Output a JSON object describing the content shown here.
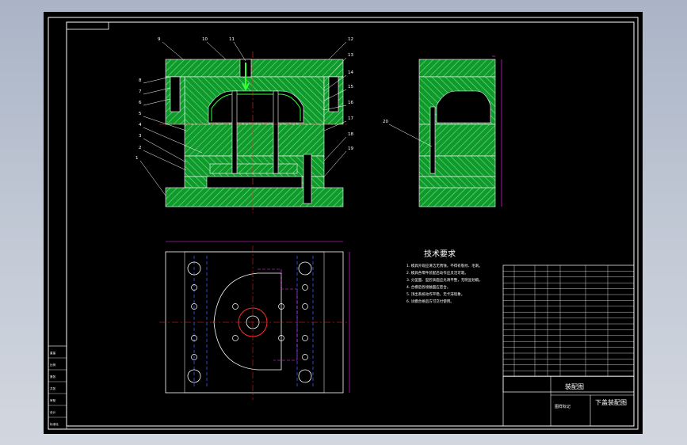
{
  "colors": {
    "canvas_bg": "#aab4c6",
    "sheet_bg": "#000000",
    "frame": "#ffffff",
    "steel": "#0f9a2c",
    "steel_hatch": "#7fe090",
    "centerline": "#ff2a2a",
    "dimension": "#ff33ff",
    "hidden": "#3a5cff",
    "annotation": "#ffffff",
    "highlight": "#33ff33"
  },
  "balloons_front": [
    "1",
    "2",
    "3",
    "4",
    "5",
    "6",
    "7",
    "8",
    "9",
    "10",
    "11",
    "12",
    "13",
    "14",
    "15",
    "16",
    "17",
    "18",
    "19"
  ],
  "balloons_side": [
    "20"
  ],
  "technical_requirements": {
    "title": "技术要求",
    "items": [
      "1. 模具外观应清洁无锈蚀，不得有裂纹、毛刺。",
      "2. 模具各零件装配后动作应灵活可靠。",
      "3. 分型面、型腔表面应光滑平整，无明显划痕。",
      "4. 合模后各接触面应密合。",
      "5. 顶出系统动作平稳，无卡滞现象。",
      "6. 试模合格后方可交付使用。"
    ]
  },
  "title_block": {
    "main_title": "装配图",
    "product_name": "下盖装配图",
    "stamp": "图样标记"
  },
  "left_table": [
    "重量",
    "比例",
    "第张",
    "共张",
    "审核",
    "设计",
    "标准化"
  ]
}
